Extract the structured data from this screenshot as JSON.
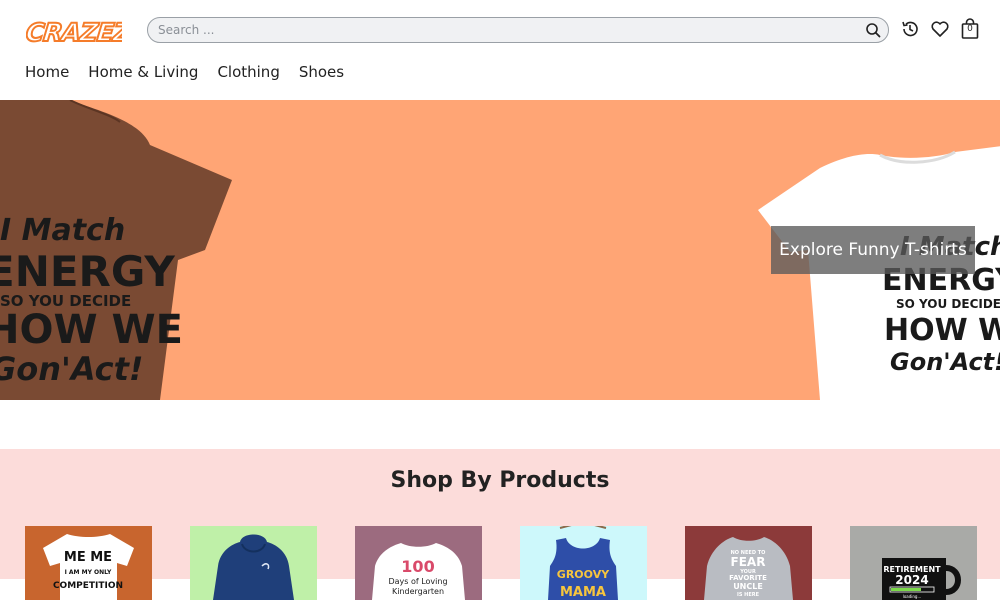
{
  "brand": {
    "logo_text": "CRAZEZY",
    "logo_color": "#f57c2a"
  },
  "search": {
    "placeholder": "Search ..."
  },
  "header_icons": [
    {
      "name": "history-icon"
    },
    {
      "name": "heart-icon"
    },
    {
      "name": "cart-icon",
      "count": "0"
    }
  ],
  "nav": {
    "items": [
      "Home",
      "Home & Living",
      "Clothing",
      "Shoes"
    ]
  },
  "hero": {
    "bg_color": "#ffa575",
    "cta_label": "Explore Funny T-shirts",
    "shirt_left_lines": [
      "I Match",
      "ENERGY",
      "SO YOU DECIDE",
      "HOW WE",
      "Gon'Act!"
    ],
    "shirt_right_lines": [
      "I Match",
      "ENERGY",
      "SO YOU DECIDE",
      "HOW WE",
      "Gon'Act!"
    ]
  },
  "shop": {
    "title": "Shop By Products",
    "bg_color": "#fcdcda",
    "cards": [
      {
        "bg": "#c8652e",
        "garment": "tshirt",
        "color": "#ffffff",
        "lines": [
          "ME ME",
          "I AM MY ONLY",
          "COMPETITION"
        ]
      },
      {
        "bg": "#bff0a8",
        "garment": "hoodie",
        "color": "#1f3f7a",
        "lines": []
      },
      {
        "bg": "#9c6b7f",
        "garment": "sweatshirt",
        "color": "#ffffff",
        "lines": [
          "100",
          "Days of Loving",
          "Kindergarten"
        ]
      },
      {
        "bg": "#cdf8fb",
        "garment": "tank",
        "color": "#2e4ea8",
        "lines": [
          "GROOVY",
          "MAMA"
        ]
      },
      {
        "bg": "#8c3a3a",
        "garment": "sweatshirt",
        "color": "#b9bcc2",
        "lines": [
          "NO NEED TO",
          "FEAR",
          "YOUR",
          "FAVORITE",
          "UNCLE",
          "IS HERE"
        ]
      },
      {
        "bg": "#a9aaa7",
        "garment": "mug",
        "color": "#111111",
        "lines": [
          "RETIREMENT",
          "2024",
          "loading..."
        ]
      }
    ]
  }
}
